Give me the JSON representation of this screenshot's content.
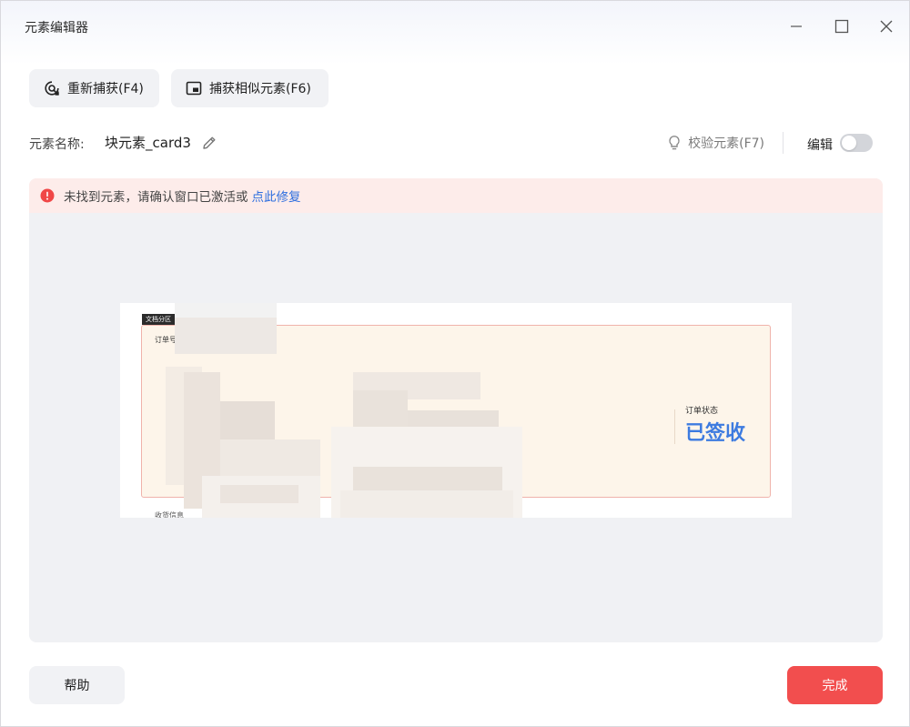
{
  "window": {
    "title": "元素编辑器"
  },
  "toolbar": {
    "recapture_label": "重新捕获(F4)",
    "capture_similar_label": "捕获相似元素(F6)"
  },
  "element": {
    "name_label": "元素名称:",
    "name_value": "块元素_card3",
    "verify_label": "校验元素(F7)",
    "edit_label": "编辑",
    "edit_toggle_on": false
  },
  "alert": {
    "message": "未找到元素，请确认窗口已激活或",
    "link": "点此修复"
  },
  "preview": {
    "tag": "文档分区",
    "status_label": "订单状态",
    "status_value": "已签收",
    "left_field": "订单号",
    "bottom_text": "收货信息"
  },
  "footer": {
    "help_label": "帮助",
    "done_label": "完成"
  },
  "colors": {
    "accent_red": "#f24e4e",
    "link_blue": "#2f6fdf",
    "status_blue": "#3d7be0",
    "alert_bg": "#fdecea"
  },
  "icons": {
    "recapture": "target-refresh-icon",
    "capture_similar": "picture-in-picture-icon",
    "edit": "pencil-icon",
    "verify": "lightbulb-icon",
    "alert": "error-circle-icon"
  }
}
